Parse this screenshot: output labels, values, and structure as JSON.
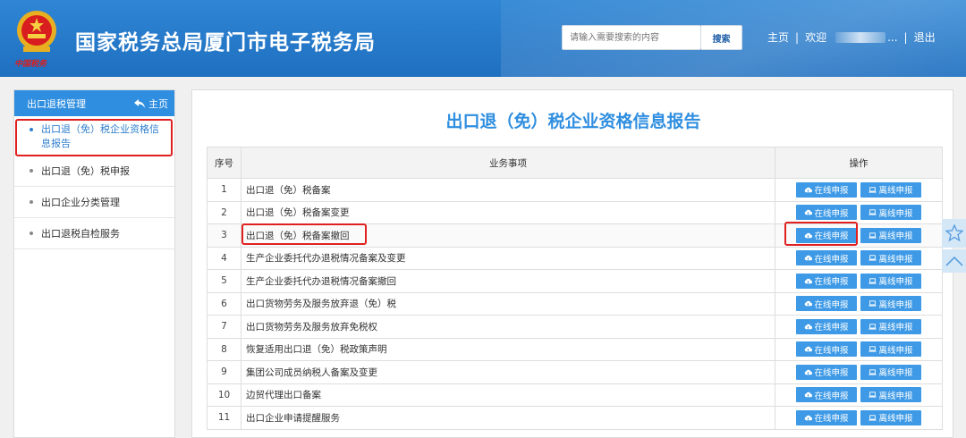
{
  "header": {
    "title": "国家税务总局厦门市电子税务局",
    "emblem_text": "中国税务",
    "search_placeholder": "请输入需要搜索的内容",
    "search_button": "搜索",
    "nav_home": "主页",
    "nav_separator": "|",
    "nav_welcome": "欢迎",
    "nav_user": "...",
    "nav_logout": "退出"
  },
  "sidebar": {
    "header_title": "出口退税管理",
    "home_link": "主页",
    "items": [
      {
        "label": "出口退（免）税企业资格信息报告",
        "active": true
      },
      {
        "label": "出口退（免）税申报"
      },
      {
        "label": "出口企业分类管理"
      },
      {
        "label": "出口退税自检服务"
      }
    ]
  },
  "main": {
    "title": "出口退（免）税企业资格信息报告",
    "columns": [
      "序号",
      "业务事项",
      "操作"
    ],
    "online_label": "在线申报",
    "offline_label": "离线申报",
    "rows": [
      {
        "no": "1",
        "item": "出口退（免）税备案"
      },
      {
        "no": "2",
        "item": "出口退（免）税备案变更"
      },
      {
        "no": "3",
        "item": "出口退（免）税备案撤回"
      },
      {
        "no": "4",
        "item": "生产企业委托代办退税情况备案及变更"
      },
      {
        "no": "5",
        "item": "生产企业委托代办退税情况备案撤回"
      },
      {
        "no": "6",
        "item": "出口货物劳务及服务放弃退（免）税"
      },
      {
        "no": "7",
        "item": "出口货物劳务及服务放弃免税权"
      },
      {
        "no": "8",
        "item": "恢复适用出口退（免）税政策声明"
      },
      {
        "no": "9",
        "item": "集团公司成员纳税人备案及变更"
      },
      {
        "no": "10",
        "item": "边贸代理出口备案"
      },
      {
        "no": "11",
        "item": "出口企业申请提醒服务"
      }
    ]
  },
  "colors": {
    "header_bg": "#2f86d4",
    "accent": "#2f8ee0",
    "button": "#3e9ae6",
    "highlight": "#e02020"
  }
}
